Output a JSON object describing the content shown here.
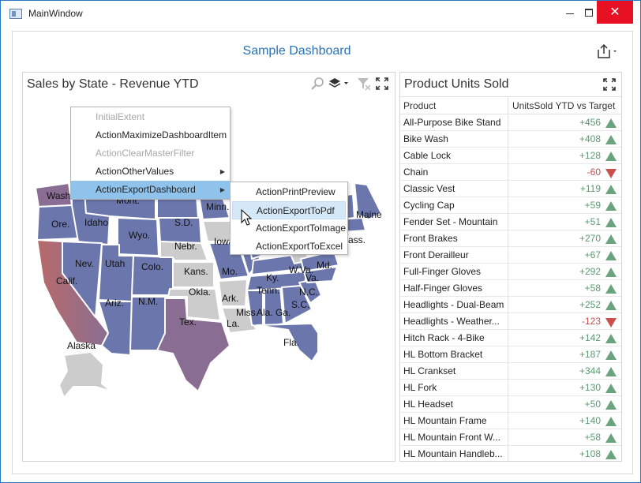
{
  "window": {
    "title": "MainWindow",
    "minimize_label": "",
    "maximize_label": "",
    "close_label": "✕"
  },
  "dashboard": {
    "title": "Sample Dashboard"
  },
  "map_panel": {
    "title": "Sales by State - Revenue YTD",
    "state_labels": [
      "Wash.",
      "Mont.",
      "Idaho",
      "Ore.",
      "Wyo.",
      "S.D.",
      "Minn.",
      "Nebr.",
      "Iowa",
      "Nev.",
      "Utah",
      "Colo.",
      "Kans.",
      "Mo.",
      "Calif.",
      "Ariz.",
      "N.M.",
      "Okla.",
      "Ark.",
      "Tenn.",
      "Ky.",
      "W.Va.",
      "Va.",
      "Md.",
      "N.C.",
      "S.C.",
      "Miss.",
      "Ala.",
      "Ga.",
      "Tex.",
      "La.",
      "Fla.",
      "Alaska",
      "Maine",
      "Mass."
    ],
    "colors": {
      "high": "#6b77ac",
      "mid": "#8a6d92",
      "low": "#b96868",
      "none": "#cccccc"
    }
  },
  "context_menu": {
    "items": [
      {
        "label": "InitialExtent",
        "enabled": false
      },
      {
        "label": "ActionMaximizeDashboardItem",
        "enabled": true
      },
      {
        "label": "ActionClearMasterFilter",
        "enabled": false
      },
      {
        "label": "ActionOtherValues",
        "enabled": true,
        "submenu": true
      },
      {
        "label": "ActionExportDashboard",
        "enabled": true,
        "submenu": true,
        "active": true
      }
    ],
    "submenu_items": [
      {
        "label": "ActionPrintPreview"
      },
      {
        "label": "ActionExportToPdf",
        "hover": true
      },
      {
        "label": "ActionExportToImage"
      },
      {
        "label": "ActionExportToExcel"
      }
    ]
  },
  "grid_panel": {
    "title": "Product Units Sold",
    "columns": [
      "Product",
      "UnitsSold YTD vs Target"
    ],
    "rows": [
      {
        "product": "All-Purpose Bike Stand",
        "delta": "+456",
        "trend": "up"
      },
      {
        "product": "Bike Wash",
        "delta": "+408",
        "trend": "up"
      },
      {
        "product": "Cable Lock",
        "delta": "+128",
        "trend": "up"
      },
      {
        "product": "Chain",
        "delta": "-60",
        "trend": "down"
      },
      {
        "product": "Classic Vest",
        "delta": "+119",
        "trend": "up"
      },
      {
        "product": "Cycling Cap",
        "delta": "+59",
        "trend": "up"
      },
      {
        "product": "Fender Set - Mountain",
        "delta": "+51",
        "trend": "up"
      },
      {
        "product": "Front Brakes",
        "delta": "+270",
        "trend": "up"
      },
      {
        "product": "Front Derailleur",
        "delta": "+67",
        "trend": "up"
      },
      {
        "product": "Full-Finger Gloves",
        "delta": "+292",
        "trend": "up"
      },
      {
        "product": "Half-Finger Gloves",
        "delta": "+58",
        "trend": "up"
      },
      {
        "product": "Headlights - Dual-Beam",
        "delta": "+252",
        "trend": "up"
      },
      {
        "product": "Headlights - Weather...",
        "delta": "-123",
        "trend": "down"
      },
      {
        "product": "Hitch Rack - 4-Bike",
        "delta": "+142",
        "trend": "up"
      },
      {
        "product": "HL Bottom Bracket",
        "delta": "+187",
        "trend": "up"
      },
      {
        "product": "HL Crankset",
        "delta": "+344",
        "trend": "up"
      },
      {
        "product": "HL Fork",
        "delta": "+130",
        "trend": "up"
      },
      {
        "product": "HL Headset",
        "delta": "+50",
        "trend": "up"
      },
      {
        "product": "HL Mountain Frame",
        "delta": "+140",
        "trend": "up"
      },
      {
        "product": "HL Mountain Front W...",
        "delta": "+58",
        "trend": "up"
      },
      {
        "product": "HL Mountain Handleb...",
        "delta": "+108",
        "trend": "up"
      }
    ]
  }
}
